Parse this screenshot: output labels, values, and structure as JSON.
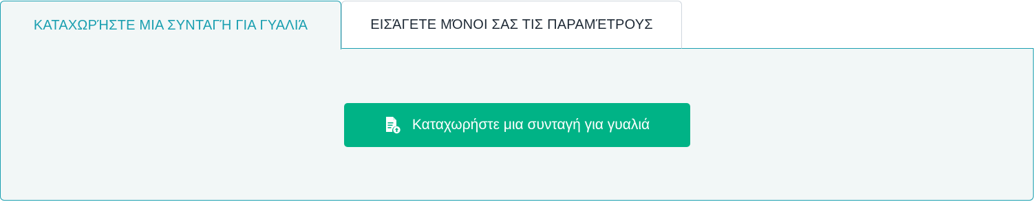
{
  "tabs": [
    {
      "label": "ΚΑΤΑΧΩΡΉΣΤΕ ΜΙΑ ΣΥΝΤΑΓΉ ΓΙΑ ΓΥΑΛΙΆ",
      "active": true
    },
    {
      "label": "ΕΙΣΆΓΕΤΕ ΜΌΝΟΙ ΣΑΣ ΤΙΣ ΠΑΡΑΜΈΤΡΟΥΣ",
      "active": false
    }
  ],
  "upload_button": {
    "label": "Καταχωρήστε μια συνταγή για γυαλιά",
    "icon": "document-upload-icon"
  },
  "colors": {
    "accent": "#1a9fb0",
    "button": "#00b386",
    "panel_bg": "#f2f7f7",
    "inactive_text": "#1f2a36"
  }
}
